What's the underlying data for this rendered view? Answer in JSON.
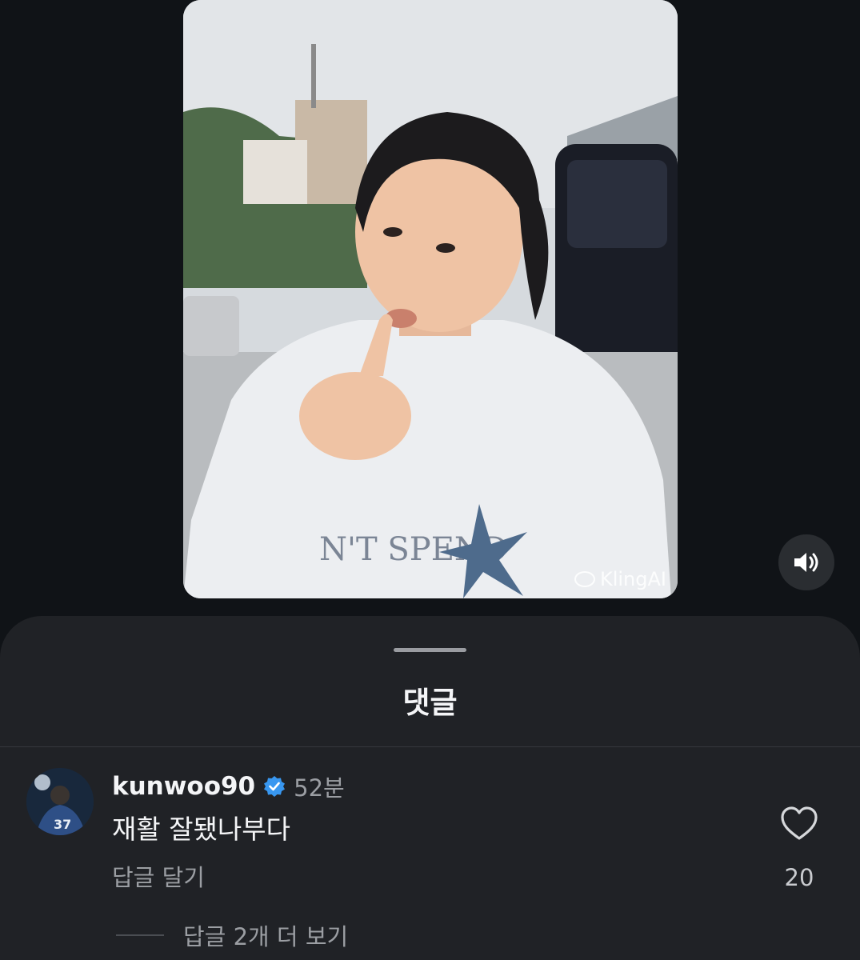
{
  "video": {
    "watermark": "KlingAI",
    "sound_icon": "speaker-on-icon"
  },
  "comments_sheet": {
    "title": "댓글",
    "comment": {
      "username": "kunwoo90",
      "verified_icon": "verified-badge-icon",
      "time": "52분",
      "text": "재활 잘됐나부다",
      "reply_label": "답글 달기",
      "like_icon": "heart-outline-icon",
      "like_count": "20",
      "view_replies_label": "답글 2개 더 보기"
    }
  },
  "colors": {
    "background": "#101317",
    "sheet": "#202226",
    "verified": "#3897f0",
    "muted_text": "#9b9ea3"
  }
}
